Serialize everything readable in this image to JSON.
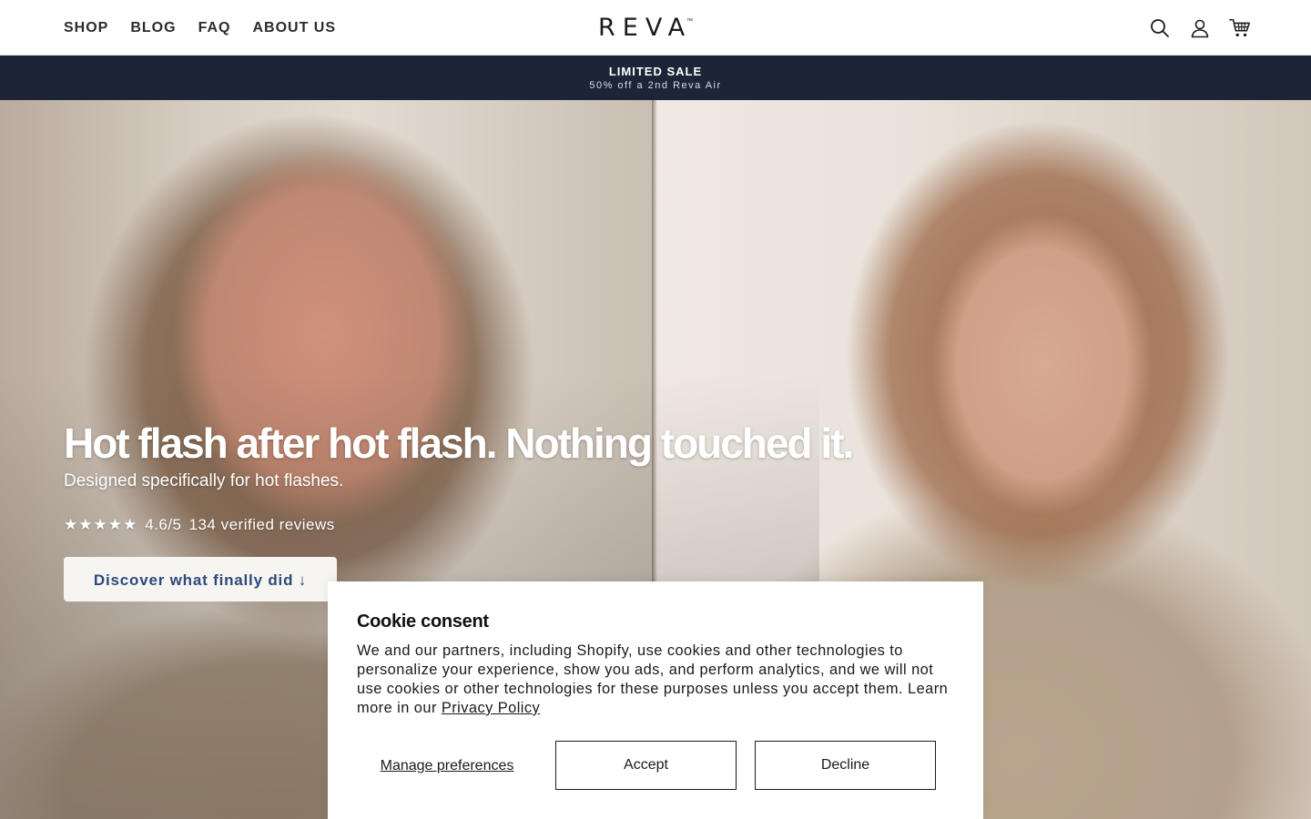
{
  "nav": {
    "items": [
      {
        "label": "SHOP"
      },
      {
        "label": "BLOG"
      },
      {
        "label": "FAQ"
      },
      {
        "label": "ABOUT US"
      }
    ]
  },
  "brand": {
    "name": "REVA",
    "trademark": "™"
  },
  "header_icons": [
    "search-icon",
    "account-icon",
    "cart-icon"
  ],
  "announcement": {
    "title": "LIMITED SALE",
    "subtitle": "50% off a 2nd Reva Air"
  },
  "hero": {
    "headline": "Hot flash after hot flash. Nothing touched it.",
    "subheadline": "Designed specifically for hot flashes.",
    "stars": "★★★★★",
    "rating": "4.6/5",
    "reviews": "134 verified reviews",
    "cta_label": "Discover what finally did ↓"
  },
  "cookie_banner": {
    "title": "Cookie consent",
    "body": "We and our partners, including Shopify, use cookies and other technologies to personalize your experience, show you ads, and perform analytics, and we will not use cookies or other technologies for these purposes unless you accept them. Learn more in our ",
    "privacy_link": "Privacy Policy",
    "manage_label": "Manage preferences",
    "accept_label": "Accept",
    "decline_label": "Decline"
  },
  "colors": {
    "announcement_bg": "#1c2537",
    "cta_text": "#2c4a7c",
    "cta_bg": "#f7f5f1"
  }
}
